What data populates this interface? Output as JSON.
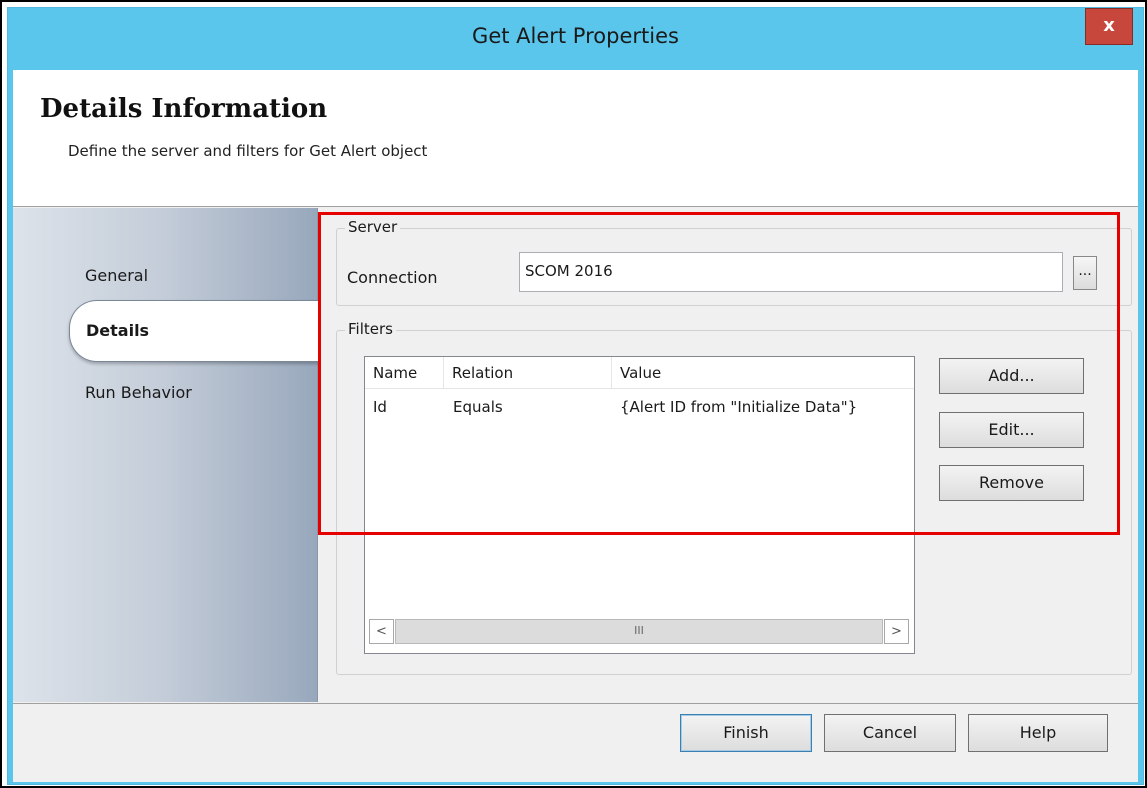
{
  "window": {
    "title": "Get Alert Properties",
    "close_label": "x"
  },
  "header": {
    "title": "Details Information",
    "subtitle": "Define the server and filters for Get Alert object"
  },
  "sidebar": {
    "items": [
      {
        "label": "General",
        "selected": false
      },
      {
        "label": "Details",
        "selected": true
      },
      {
        "label": "Run Behavior",
        "selected": false
      }
    ]
  },
  "server_group": {
    "label": "Server",
    "connection_label": "Connection",
    "connection_value": "SCOM 2016",
    "browse_label": "..."
  },
  "filters_group": {
    "label": "Filters",
    "columns": [
      "Name",
      "Relation",
      "Value"
    ],
    "rows": [
      {
        "name": "Id",
        "relation": "Equals",
        "value": "{Alert ID from \"Initialize Data\"}"
      }
    ],
    "scroll_left": "<",
    "scroll_right": ">",
    "scroll_grip": "III",
    "buttons": {
      "add": "Add...",
      "edit": "Edit...",
      "remove": "Remove"
    }
  },
  "footer": {
    "finish": "Finish",
    "cancel": "Cancel",
    "help": "Help"
  },
  "colors": {
    "titlebar": "#5ac6ec",
    "close": "#c8473c",
    "highlight_box": "#e60000"
  }
}
